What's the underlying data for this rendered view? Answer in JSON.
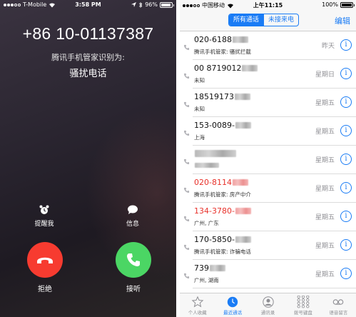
{
  "incoming_call": {
    "status_bar": {
      "carrier": "T-Mobile",
      "time": "3:58 PM",
      "battery": "96%"
    },
    "phone_number": "+86 10-01137387",
    "identified_by": "腾讯手机管家识别为:",
    "tag": "骚扰电话",
    "remind_label": "提醒我",
    "message_label": "信息",
    "decline_label": "拒绝",
    "accept_label": "接听",
    "colors": {
      "decline": "#f73b30",
      "accept": "#4bd664"
    }
  },
  "recents": {
    "status_bar": {
      "carrier": "中国移动",
      "time": "上午11:15",
      "battery": "100%"
    },
    "segment": {
      "all": "所有通话",
      "missed": "未接来电"
    },
    "edit_label": "编辑",
    "calls": [
      {
        "number": "020-6188",
        "blurred": true,
        "missed": false,
        "sub": "腾讯手机管家: 骚扰拦截",
        "day": "昨天"
      },
      {
        "number": "00 8719012",
        "blurred": true,
        "missed": false,
        "sub": "未知",
        "day": "星期日"
      },
      {
        "number": "18519173",
        "blurred": true,
        "missed": false,
        "sub": "未知",
        "day": "星期五"
      },
      {
        "number": "153-0089-",
        "blurred": true,
        "missed": false,
        "sub": "上海",
        "day": "星期五"
      },
      {
        "number": "",
        "blurred": true,
        "missed": false,
        "sub": "",
        "day": "星期五"
      },
      {
        "number": "020-8114",
        "blurred": true,
        "missed": true,
        "sub": "腾讯手机管家: 房产中介",
        "day": "星期五"
      },
      {
        "number": "134-3780-",
        "blurred": true,
        "missed": true,
        "sub": "广州, 广东",
        "day": "星期五"
      },
      {
        "number": "170-5850-",
        "blurred": true,
        "missed": false,
        "sub": "腾讯手机管家: 诈骗电话",
        "day": "星期五"
      },
      {
        "number": "739",
        "blurred": true,
        "missed": false,
        "sub": "广州, 湖南",
        "day": "星期五"
      }
    ],
    "tabs": [
      {
        "label": "个人收藏",
        "icon": "star-icon",
        "active": false
      },
      {
        "label": "最近通话",
        "icon": "clock-icon",
        "active": true
      },
      {
        "label": "通讯录",
        "icon": "contacts-icon",
        "active": false
      },
      {
        "label": "拨号键盘",
        "icon": "keypad-icon",
        "active": false
      },
      {
        "label": "语音留言",
        "icon": "voicemail-icon",
        "active": false
      }
    ],
    "colors": {
      "accent": "#1a7cf5",
      "missed": "#e8322b"
    }
  }
}
